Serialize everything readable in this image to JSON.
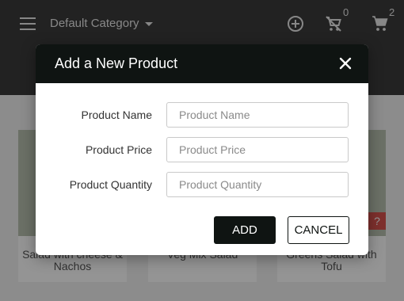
{
  "header": {
    "category_label": "Default Category",
    "empty_cart_count": "0",
    "cart_count": "2"
  },
  "products": [
    {
      "title": "Salad with cheese & Nachos"
    },
    {
      "title": "Veg Mix Salad"
    },
    {
      "title": "Greens Salad with Tofu",
      "tag": "?"
    }
  ],
  "modal": {
    "title": "Add a New Product",
    "fields": [
      {
        "label": "Product Name",
        "placeholder": "Product Name",
        "value": ""
      },
      {
        "label": "Product Price",
        "placeholder": "Product Price",
        "value": ""
      },
      {
        "label": "Product Quantity",
        "placeholder": "Product Quantity",
        "value": ""
      }
    ],
    "add_label": "ADD",
    "cancel_label": "CANCEL"
  },
  "colors": {
    "primary_dark": "#0f1412",
    "topbar": "#3b3b3b",
    "tag_red": "#d9534f"
  },
  "icons": [
    "menu-icon",
    "chevron-down-icon",
    "add-circle-icon",
    "remove-shopping-cart-icon",
    "shopping-cart-icon",
    "close-icon"
  ]
}
